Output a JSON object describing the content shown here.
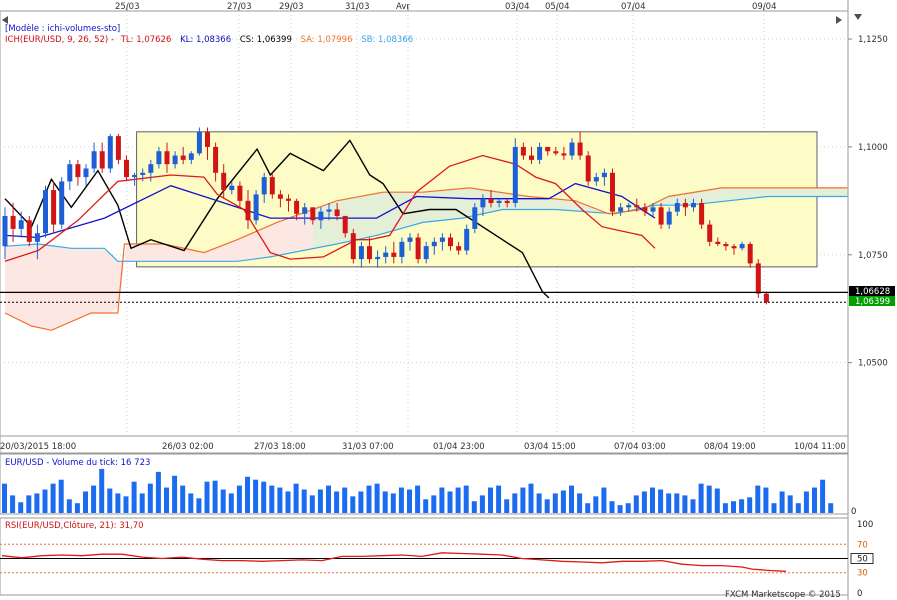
{
  "top_dates": [
    "25/03",
    "27/03",
    "29/03",
    "31/03",
    "Avr",
    "03/04",
    "05/04",
    "07/04",
    "09/04"
  ],
  "bottom_dates": [
    "20/03/2015 18:00",
    "26/03 02:00",
    "27/03 18:00",
    "31/03 07:00",
    "01/04 23:00",
    "03/04 15:00",
    "07/04 03:00",
    "08/04 19:00",
    "10/04 11:00"
  ],
  "header": {
    "model": "[Modèle : ichi-volumes-sto]",
    "ich_label": "ICH(EUR/USD, 9, 26, 52) -",
    "tl": "TL: 1,07626",
    "kl": "KL: 1,08366",
    "cs": "CS: 1,06399",
    "sa": "SA: 1,07996",
    "sb": "SB: 1,08366"
  },
  "price_axis": {
    "ticks": [
      "1,1250",
      "1,1000",
      "1,0750",
      "1,0500"
    ],
    "tag_upper": "1,06628",
    "tag_lower": "1,06399"
  },
  "volume_panel": {
    "title": "EUR/USD - Volume du tick: 16 723",
    "axis_zero": "0",
    "values": [
      30,
      18,
      11,
      18,
      20,
      24,
      30,
      34,
      14,
      10,
      22,
      28,
      45,
      25,
      20,
      17,
      32,
      20,
      30,
      42,
      26,
      38,
      28,
      20,
      15,
      32,
      33,
      24,
      20,
      28,
      37,
      34,
      32,
      28,
      26,
      22,
      30,
      24,
      18,
      24,
      28,
      22,
      26,
      17,
      22,
      28,
      30,
      22,
      20,
      26,
      24,
      28,
      14,
      18,
      26,
      22,
      26,
      28,
      12,
      18,
      26,
      28,
      14,
      20,
      26,
      30,
      20,
      14,
      20,
      23,
      28,
      20,
      10,
      17,
      26,
      12,
      8,
      10,
      18,
      22,
      26,
      24,
      20,
      20,
      18,
      14,
      30,
      28,
      25,
      10,
      12,
      14,
      16,
      28,
      26,
      10,
      22,
      18,
      10,
      22,
      26,
      34,
      10
    ]
  },
  "rsi_panel": {
    "title": "RSI(EUR/USD,Clôture, 21): 31,70",
    "axis_labels": [
      "100",
      "70",
      "50",
      "30",
      "0"
    ]
  },
  "footer": {
    "copyright": "FXCM Marketscope © 2015"
  },
  "colors": {
    "bull": "#1f5fd6",
    "bear": "#d11414",
    "tenkan": "#e01818",
    "kijun": "#1414c8",
    "chikou": "#000000",
    "span_a": "#f07030",
    "span_b": "#3aa8e8",
    "volume": "#1c6cf0",
    "rsi": "#e01818",
    "box_fill": "#fdfcc6"
  },
  "chart_data": [
    {
      "type": "candlestick",
      "title": "ICH(EUR/USD, 9, 26, 52)",
      "ylim": [
        1.033,
        1.1315
      ],
      "x_ticks": [
        "20/03/2015 18:00",
        "26/03 02:00",
        "27/03 18:00",
        "31/03 07:00",
        "01/04 23:00",
        "03/04 15:00",
        "07/04 03:00",
        "08/04 19:00",
        "10/04 11:00"
      ],
      "y_ticks": [
        1.05,
        1.075,
        1.1,
        1.125
      ],
      "ohlc": [
        [
          1.077,
          1.086,
          1.074,
          1.084
        ],
        [
          1.084,
          1.087,
          1.078,
          1.081
        ],
        [
          1.081,
          1.085,
          1.079,
          1.083
        ],
        [
          1.083,
          1.084,
          1.077,
          1.078
        ],
        [
          1.078,
          1.082,
          1.074,
          1.08
        ],
        [
          1.08,
          1.091,
          1.079,
          1.09
        ],
        [
          1.09,
          1.092,
          1.08,
          1.082
        ],
        [
          1.082,
          1.093,
          1.081,
          1.092
        ],
        [
          1.092,
          1.097,
          1.09,
          1.096
        ],
        [
          1.096,
          1.097,
          1.091,
          1.093
        ],
        [
          1.093,
          1.096,
          1.091,
          1.095
        ],
        [
          1.095,
          1.101,
          1.094,
          1.099
        ],
        [
          1.099,
          1.101,
          1.094,
          1.095
        ],
        [
          1.095,
          1.103,
          1.094,
          1.1025
        ],
        [
          1.1025,
          1.103,
          1.096,
          1.097
        ],
        [
          1.097,
          1.098,
          1.092,
          1.093
        ],
        [
          1.093,
          1.094,
          1.091,
          1.0935
        ],
        [
          1.0935,
          1.095,
          1.092,
          1.094
        ],
        [
          1.094,
          1.097,
          1.092,
          1.096
        ],
        [
          1.096,
          1.1,
          1.095,
          1.099
        ],
        [
          1.099,
          1.101,
          1.094,
          1.096
        ],
        [
          1.096,
          1.099,
          1.095,
          1.098
        ],
        [
          1.098,
          1.1,
          1.096,
          1.097
        ],
        [
          1.097,
          1.099,
          1.096,
          1.0985
        ],
        [
          1.0985,
          1.1045,
          1.098,
          1.1035
        ],
        [
          1.1035,
          1.1045,
          1.097,
          1.1
        ],
        [
          1.1,
          1.101,
          1.092,
          1.094
        ],
        [
          1.094,
          1.096,
          1.088,
          1.09
        ],
        [
          1.09,
          1.092,
          1.089,
          1.091
        ],
        [
          1.091,
          1.092,
          1.086,
          1.0875
        ],
        [
          1.0875,
          1.09,
          1.081,
          1.083
        ],
        [
          1.083,
          1.09,
          1.082,
          1.089
        ],
        [
          1.089,
          1.094,
          1.087,
          1.093
        ],
        [
          1.093,
          1.094,
          1.088,
          1.089
        ],
        [
          1.089,
          1.09,
          1.086,
          1.088
        ],
        [
          1.088,
          1.089,
          1.085,
          1.0875
        ],
        [
          1.0875,
          1.088,
          1.083,
          1.0845
        ],
        [
          1.0845,
          1.087,
          1.082,
          1.086
        ],
        [
          1.086,
          1.086,
          1.082,
          1.083
        ],
        [
          1.083,
          1.086,
          1.081,
          1.085
        ],
        [
          1.085,
          1.087,
          1.083,
          1.0855
        ],
        [
          1.0855,
          1.087,
          1.083,
          1.084
        ],
        [
          1.084,
          1.084,
          1.079,
          1.08
        ],
        [
          1.08,
          1.081,
          1.073,
          1.074
        ],
        [
          1.074,
          1.078,
          1.072,
          1.077
        ],
        [
          1.077,
          1.079,
          1.073,
          1.074
        ],
        [
          1.074,
          1.076,
          1.072,
          1.0745
        ],
        [
          1.0745,
          1.077,
          1.073,
          1.0755
        ],
        [
          1.0755,
          1.078,
          1.073,
          1.0745
        ],
        [
          1.0745,
          1.079,
          1.073,
          1.078
        ],
        [
          1.078,
          1.08,
          1.076,
          1.079
        ],
        [
          1.079,
          1.08,
          1.073,
          1.074
        ],
        [
          1.074,
          1.078,
          1.073,
          1.077
        ],
        [
          1.077,
          1.079,
          1.075,
          1.078
        ],
        [
          1.078,
          1.08,
          1.076,
          1.079
        ],
        [
          1.079,
          1.08,
          1.076,
          1.077
        ],
        [
          1.077,
          1.078,
          1.075,
          1.076
        ],
        [
          1.076,
          1.082,
          1.075,
          1.081
        ],
        [
          1.081,
          1.087,
          1.08,
          1.086
        ],
        [
          1.086,
          1.089,
          1.084,
          1.088
        ],
        [
          1.088,
          1.09,
          1.086,
          1.087
        ],
        [
          1.087,
          1.088,
          1.086,
          1.0875
        ],
        [
          1.0875,
          1.088,
          1.086,
          1.087
        ],
        [
          1.087,
          1.102,
          1.086,
          1.1
        ],
        [
          1.1,
          1.101,
          1.097,
          1.098
        ],
        [
          1.098,
          1.1,
          1.096,
          1.097
        ],
        [
          1.097,
          1.101,
          1.096,
          1.1
        ],
        [
          1.1,
          1.1,
          1.098,
          1.099
        ],
        [
          1.099,
          1.1,
          1.098,
          1.0985
        ],
        [
          1.0985,
          1.1,
          1.097,
          1.098
        ],
        [
          1.098,
          1.102,
          1.097,
          1.101
        ],
        [
          1.101,
          1.1035,
          1.097,
          1.098
        ],
        [
          1.098,
          1.099,
          1.091,
          1.092
        ],
        [
          1.092,
          1.094,
          1.091,
          1.093
        ],
        [
          1.093,
          1.095,
          1.091,
          1.094
        ],
        [
          1.094,
          1.095,
          1.084,
          1.085
        ],
        [
          1.085,
          1.087,
          1.084,
          1.086
        ],
        [
          1.086,
          1.087,
          1.085,
          1.0865
        ],
        [
          1.0865,
          1.088,
          1.085,
          1.086
        ],
        [
          1.086,
          1.087,
          1.084,
          1.085
        ],
        [
          1.085,
          1.087,
          1.084,
          1.086
        ],
        [
          1.086,
          1.087,
          1.081,
          1.082
        ],
        [
          1.082,
          1.086,
          1.081,
          1.085
        ],
        [
          1.085,
          1.088,
          1.084,
          1.087
        ],
        [
          1.087,
          1.088,
          1.084,
          1.086
        ],
        [
          1.086,
          1.088,
          1.085,
          1.087
        ],
        [
          1.087,
          1.088,
          1.081,
          1.082
        ],
        [
          1.082,
          1.083,
          1.077,
          1.078
        ],
        [
          1.078,
          1.079,
          1.077,
          1.0775
        ],
        [
          1.0775,
          1.078,
          1.076,
          1.077
        ],
        [
          1.077,
          1.0775,
          1.075,
          1.0765
        ],
        [
          1.0765,
          1.078,
          1.076,
          1.0775
        ],
        [
          1.0775,
          1.078,
          1.072,
          1.073
        ],
        [
          1.073,
          1.074,
          1.065,
          1.066
        ],
        [
          1.066,
          1.0665,
          1.0635,
          1.064
        ]
      ],
      "tenkan": [
        [
          0,
          1.0735
        ],
        [
          10,
          1.076
        ],
        [
          22,
          1.083
        ],
        [
          34,
          1.092
        ],
        [
          50,
          1.0935
        ],
        [
          60,
          1.093
        ],
        [
          64,
          1.089
        ],
        [
          72,
          1.0855
        ],
        [
          80,
          1.0755
        ],
        [
          86,
          1.074
        ],
        [
          96,
          1.0745
        ],
        [
          106,
          1.0785
        ],
        [
          110,
          1.0785
        ],
        [
          116,
          1.0795
        ],
        [
          124,
          1.0895
        ],
        [
          134,
          1.0955
        ],
        [
          144,
          1.098
        ],
        [
          154,
          1.096
        ],
        [
          160,
          1.093
        ],
        [
          166,
          1.0915
        ],
        [
          174,
          1.0855
        ],
        [
          180,
          1.0815
        ],
        [
          186,
          1.0805
        ],
        [
          192,
          1.0795
        ],
        [
          196,
          1.0765
        ]
      ],
      "kijun": [
        [
          0,
          1.0795
        ],
        [
          10,
          1.079
        ],
        [
          30,
          1.0835
        ],
        [
          50,
          1.091
        ],
        [
          64,
          1.0875
        ],
        [
          80,
          1.0835
        ],
        [
          100,
          1.0835
        ],
        [
          112,
          1.0835
        ],
        [
          124,
          1.0885
        ],
        [
          140,
          1.088
        ],
        [
          164,
          1.088
        ],
        [
          172,
          1.0915
        ],
        [
          186,
          1.0885
        ],
        [
          196,
          1.0835
        ]
      ],
      "chikou": [
        [
          0,
          1.088
        ],
        [
          8,
          1.0815
        ],
        [
          14,
          1.0925
        ],
        [
          20,
          1.086
        ],
        [
          28,
          1.0945
        ],
        [
          34,
          1.0865
        ],
        [
          38,
          1.0765
        ],
        [
          44,
          1.0785
        ],
        [
          54,
          1.076
        ],
        [
          64,
          1.088
        ],
        [
          76,
          1.0995
        ],
        [
          80,
          1.0935
        ],
        [
          86,
          1.0985
        ],
        [
          96,
          1.0945
        ],
        [
          104,
          1.1015
        ],
        [
          110,
          1.0935
        ],
        [
          114,
          1.0915
        ],
        [
          120,
          1.0845
        ],
        [
          128,
          1.0855
        ],
        [
          136,
          1.0855
        ],
        [
          140,
          1.0835
        ],
        [
          150,
          1.0785
        ],
        [
          156,
          1.0755
        ],
        [
          162,
          1.0665
        ],
        [
          164,
          1.065
        ]
      ],
      "span_a": [
        [
          0,
          1.0615
        ],
        [
          8,
          1.0585
        ],
        [
          14,
          1.0575
        ],
        [
          26,
          1.0615
        ],
        [
          34,
          1.0615
        ],
        [
          36,
          1.0775
        ],
        [
          48,
          1.0775
        ],
        [
          60,
          1.0755
        ],
        [
          70,
          1.0785
        ],
        [
          82,
          1.0825
        ],
        [
          100,
          1.0875
        ],
        [
          114,
          1.0895
        ],
        [
          126,
          1.0895
        ],
        [
          140,
          1.0905
        ],
        [
          158,
          1.0885
        ],
        [
          172,
          1.0875
        ],
        [
          182,
          1.0845
        ],
        [
          192,
          1.0855
        ],
        [
          200,
          1.0885
        ],
        [
          216,
          1.0905
        ],
        [
          236,
          1.0905
        ],
        [
          254,
          1.0905
        ]
      ],
      "span_b": [
        [
          0,
          1.077
        ],
        [
          10,
          1.0775
        ],
        [
          20,
          1.0765
        ],
        [
          30,
          1.0765
        ],
        [
          34,
          1.0735
        ],
        [
          40,
          1.0735
        ],
        [
          70,
          1.0735
        ],
        [
          80,
          1.0745
        ],
        [
          100,
          1.0775
        ],
        [
          112,
          1.0795
        ],
        [
          126,
          1.0825
        ],
        [
          138,
          1.0835
        ],
        [
          150,
          1.0855
        ],
        [
          166,
          1.0855
        ],
        [
          184,
          1.0845
        ],
        [
          196,
          1.0865
        ],
        [
          206,
          1.0865
        ],
        [
          230,
          1.0885
        ],
        [
          254,
          1.0885
        ]
      ],
      "levels": {
        "resistance_line": 1.06628,
        "close_dotted": 1.06399,
        "box_top": 1.1035,
        "box_bottom": 1.0722
      }
    },
    {
      "type": "bar",
      "title": "EUR/USD - Volume du tick: 16 723",
      "ylim": [
        0,
        48
      ]
    },
    {
      "type": "line",
      "title": "RSI(EUR/USD,Clôture, 21): 31,70",
      "ylim": [
        0,
        100
      ],
      "y_ticks": [
        100,
        70,
        50,
        30,
        0
      ],
      "values": [
        [
          0,
          54
        ],
        [
          10,
          51
        ],
        [
          20,
          54
        ],
        [
          30,
          55
        ],
        [
          40,
          54
        ],
        [
          50,
          56
        ],
        [
          60,
          56
        ],
        [
          70,
          52
        ],
        [
          80,
          50
        ],
        [
          90,
          52
        ],
        [
          100,
          49
        ],
        [
          110,
          47
        ],
        [
          120,
          47
        ],
        [
          130,
          46
        ],
        [
          140,
          47
        ],
        [
          150,
          48
        ],
        [
          160,
          47
        ],
        [
          170,
          53
        ],
        [
          180,
          53
        ],
        [
          190,
          54
        ],
        [
          200,
          55
        ],
        [
          210,
          53
        ],
        [
          220,
          58
        ],
        [
          230,
          57
        ],
        [
          240,
          56
        ],
        [
          250,
          55
        ],
        [
          260,
          50
        ],
        [
          270,
          48
        ],
        [
          280,
          46
        ],
        [
          290,
          45
        ],
        [
          300,
          44
        ],
        [
          310,
          46
        ],
        [
          320,
          46
        ],
        [
          330,
          47
        ],
        [
          340,
          42
        ],
        [
          350,
          40
        ],
        [
          360,
          40
        ],
        [
          370,
          38
        ],
        [
          375,
          35
        ],
        [
          385,
          33
        ],
        [
          392,
          32
        ]
      ]
    }
  ]
}
